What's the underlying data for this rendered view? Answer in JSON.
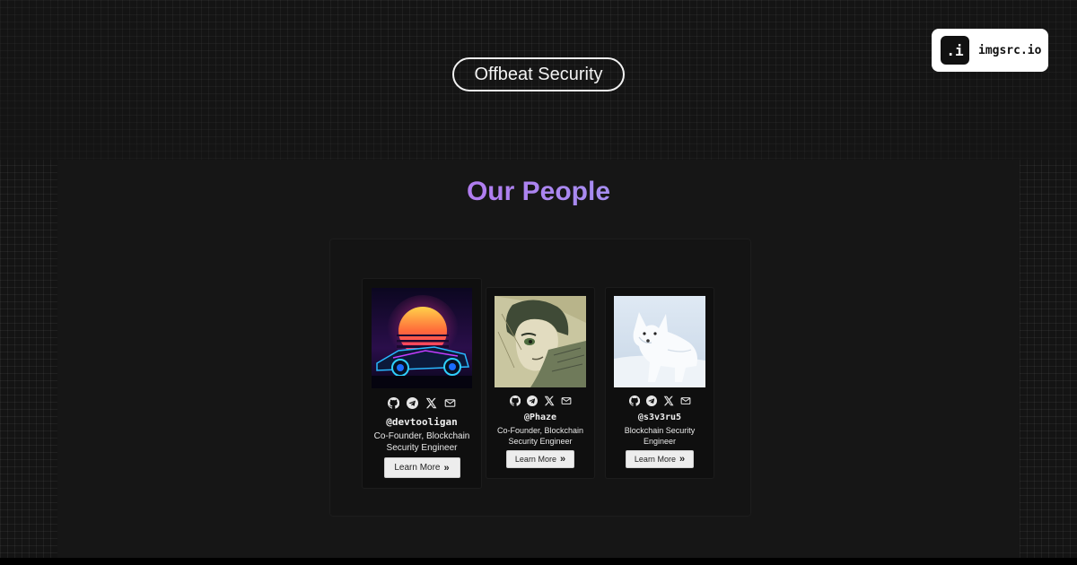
{
  "header": {
    "brand_badge": "Offbeat Security",
    "watermark_logo": ".i",
    "watermark_text": "imgsrc.io"
  },
  "section": {
    "title": "Our People"
  },
  "people": [
    {
      "handle": "@devtooligan",
      "role": "Co-Founder, Blockchain Security Engineer",
      "button": "Learn More",
      "button_icon": "»",
      "avatar": "synthwave-car-sunset"
    },
    {
      "handle": "@Phaze",
      "role": "Co-Founder, Blockchain Security Engineer",
      "button": "Learn More",
      "button_icon": "»",
      "avatar": "anime-sketch-portrait"
    },
    {
      "handle": "@s3v3ru5",
      "role": "Blockchain Security Engineer",
      "button": "Learn More",
      "button_icon": "»",
      "avatar": "white-arctic-fox"
    }
  ],
  "social_icons": [
    "github-icon",
    "telegram-icon",
    "x-icon",
    "mail-icon"
  ],
  "colors": {
    "background": "#141414",
    "panel": "#161616",
    "card": "#0f0f0f",
    "title_gradient_start": "#d95bf5",
    "title_gradient_end": "#7fc6ee"
  }
}
